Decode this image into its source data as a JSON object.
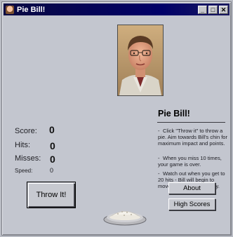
{
  "window": {
    "title": "Pie Bill!",
    "controls": {
      "minimize": "_",
      "maximize": "□",
      "close": "✕"
    }
  },
  "game": {
    "heading": "Pie Bill!",
    "instructions": [
      "Click \"Throw it\" to throw a pie. Aim towards Bill's chin for maximum impact and points.",
      "When you miss 10 times, your game is over.",
      "Watch out when you get to 20 hits - Bill will begin to move like a crazy monkey."
    ],
    "bullet": "-",
    "score": {
      "label": "Score:",
      "value": "0"
    },
    "hits": {
      "label": "Hits:",
      "value": "0"
    },
    "misses": {
      "label": "Misses:",
      "value": "0"
    },
    "speed": {
      "label": "Speed:",
      "value": "0"
    }
  },
  "buttons": {
    "throw": "Throw It!",
    "about": "About",
    "high_scores": "High Scores"
  },
  "icons": {
    "app": "app-icon",
    "target": "bill-photo",
    "projectile": "pie-icon"
  },
  "colors": {
    "titlebar": "#000068",
    "window_bg": "#c3c6cf",
    "button_face": "#c7c9d0"
  }
}
